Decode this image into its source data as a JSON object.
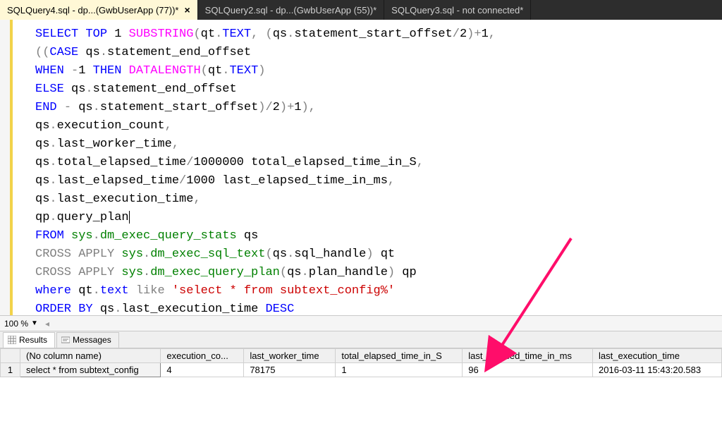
{
  "tabs": [
    {
      "label": "SQLQuery4.sql - dp...(GwbUserApp (77))*",
      "active": true
    },
    {
      "label": "SQLQuery2.sql - dp...(GwbUserApp (55))*",
      "active": false
    },
    {
      "label": "SQLQuery3.sql - not connected*",
      "active": false
    }
  ],
  "editor": {
    "lines": [
      [
        {
          "c": "kw",
          "t": "SELECT"
        },
        {
          "c": "id",
          "t": " "
        },
        {
          "c": "kw",
          "t": "TOP"
        },
        {
          "c": "id",
          "t": " "
        },
        {
          "c": "num",
          "t": "1"
        },
        {
          "c": "id",
          "t": " "
        },
        {
          "c": "fn",
          "t": "SUBSTRING"
        },
        {
          "c": "punc",
          "t": "("
        },
        {
          "c": "id",
          "t": "qt"
        },
        {
          "c": "punc",
          "t": "."
        },
        {
          "c": "kw",
          "t": "TEXT"
        },
        {
          "c": "punc",
          "t": ", ("
        },
        {
          "c": "id",
          "t": "qs"
        },
        {
          "c": "punc",
          "t": "."
        },
        {
          "c": "id",
          "t": "statement_start_offset"
        },
        {
          "c": "punc",
          "t": "/"
        },
        {
          "c": "num",
          "t": "2"
        },
        {
          "c": "punc",
          "t": ")+"
        },
        {
          "c": "num",
          "t": "1"
        },
        {
          "c": "punc",
          "t": ","
        }
      ],
      [
        {
          "c": "punc",
          "t": "(("
        },
        {
          "c": "kw",
          "t": "CASE"
        },
        {
          "c": "id",
          "t": " qs"
        },
        {
          "c": "punc",
          "t": "."
        },
        {
          "c": "id",
          "t": "statement_end_offset"
        }
      ],
      [
        {
          "c": "kw",
          "t": "WHEN"
        },
        {
          "c": "id",
          "t": " "
        },
        {
          "c": "punc",
          "t": "-"
        },
        {
          "c": "num",
          "t": "1"
        },
        {
          "c": "id",
          "t": " "
        },
        {
          "c": "kw",
          "t": "THEN"
        },
        {
          "c": "id",
          "t": " "
        },
        {
          "c": "fn",
          "t": "DATALENGTH"
        },
        {
          "c": "punc",
          "t": "("
        },
        {
          "c": "id",
          "t": "qt"
        },
        {
          "c": "punc",
          "t": "."
        },
        {
          "c": "kw",
          "t": "TEXT"
        },
        {
          "c": "punc",
          "t": ")"
        }
      ],
      [
        {
          "c": "kw",
          "t": "ELSE"
        },
        {
          "c": "id",
          "t": " qs"
        },
        {
          "c": "punc",
          "t": "."
        },
        {
          "c": "id",
          "t": "statement_end_offset"
        }
      ],
      [
        {
          "c": "kw",
          "t": "END"
        },
        {
          "c": "id",
          "t": " "
        },
        {
          "c": "punc",
          "t": "-"
        },
        {
          "c": "id",
          "t": " qs"
        },
        {
          "c": "punc",
          "t": "."
        },
        {
          "c": "id",
          "t": "statement_start_offset"
        },
        {
          "c": "punc",
          "t": ")/"
        },
        {
          "c": "num",
          "t": "2"
        },
        {
          "c": "punc",
          "t": ")+"
        },
        {
          "c": "num",
          "t": "1"
        },
        {
          "c": "punc",
          "t": "),"
        }
      ],
      [
        {
          "c": "id",
          "t": "qs"
        },
        {
          "c": "punc",
          "t": "."
        },
        {
          "c": "id",
          "t": "execution_count"
        },
        {
          "c": "punc",
          "t": ","
        }
      ],
      [
        {
          "c": "id",
          "t": "qs"
        },
        {
          "c": "punc",
          "t": "."
        },
        {
          "c": "id",
          "t": "last_worker_time"
        },
        {
          "c": "punc",
          "t": ","
        }
      ],
      [
        {
          "c": "id",
          "t": "qs"
        },
        {
          "c": "punc",
          "t": "."
        },
        {
          "c": "id",
          "t": "total_elapsed_time"
        },
        {
          "c": "punc",
          "t": "/"
        },
        {
          "c": "num",
          "t": "1000000"
        },
        {
          "c": "id",
          "t": " total_elapsed_time_in_S"
        },
        {
          "c": "punc",
          "t": ","
        }
      ],
      [
        {
          "c": "id",
          "t": "qs"
        },
        {
          "c": "punc",
          "t": "."
        },
        {
          "c": "id",
          "t": "last_elapsed_time"
        },
        {
          "c": "punc",
          "t": "/"
        },
        {
          "c": "num",
          "t": "1000"
        },
        {
          "c": "id",
          "t": " last_elapsed_time_in_ms"
        },
        {
          "c": "punc",
          "t": ","
        }
      ],
      [
        {
          "c": "id",
          "t": "qs"
        },
        {
          "c": "punc",
          "t": "."
        },
        {
          "c": "id",
          "t": "last_execution_time"
        },
        {
          "c": "punc",
          "t": ","
        }
      ],
      [
        {
          "c": "id",
          "t": "qp"
        },
        {
          "c": "punc",
          "t": "."
        },
        {
          "c": "id",
          "t": "query_plan"
        },
        {
          "c": "cursor",
          "t": ""
        }
      ],
      [
        {
          "c": "kw",
          "t": "FROM"
        },
        {
          "c": "id",
          "t": " "
        },
        {
          "c": "sys",
          "t": "sys"
        },
        {
          "c": "punc",
          "t": "."
        },
        {
          "c": "sys",
          "t": "dm_exec_query_stats"
        },
        {
          "c": "id",
          "t": " qs"
        }
      ],
      [
        {
          "c": "punc",
          "t": "CROSS APPLY "
        },
        {
          "c": "sys",
          "t": "sys"
        },
        {
          "c": "punc",
          "t": "."
        },
        {
          "c": "sys",
          "t": "dm_exec_sql_text"
        },
        {
          "c": "punc",
          "t": "("
        },
        {
          "c": "id",
          "t": "qs"
        },
        {
          "c": "punc",
          "t": "."
        },
        {
          "c": "id",
          "t": "sql_handle"
        },
        {
          "c": "punc",
          "t": ")"
        },
        {
          "c": "id",
          "t": " qt"
        }
      ],
      [
        {
          "c": "punc",
          "t": "CROSS APPLY "
        },
        {
          "c": "sys",
          "t": "sys"
        },
        {
          "c": "punc",
          "t": "."
        },
        {
          "c": "sys",
          "t": "dm_exec_query_plan"
        },
        {
          "c": "punc",
          "t": "("
        },
        {
          "c": "id",
          "t": "qs"
        },
        {
          "c": "punc",
          "t": "."
        },
        {
          "c": "id",
          "t": "plan_handle"
        },
        {
          "c": "punc",
          "t": ")"
        },
        {
          "c": "id",
          "t": " qp"
        }
      ],
      [
        {
          "c": "kw",
          "t": "where"
        },
        {
          "c": "id",
          "t": " qt"
        },
        {
          "c": "punc",
          "t": "."
        },
        {
          "c": "kw",
          "t": "text"
        },
        {
          "c": "id",
          "t": " "
        },
        {
          "c": "punc",
          "t": "like"
        },
        {
          "c": "id",
          "t": " "
        },
        {
          "c": "str",
          "t": "'select * from subtext_config%'"
        }
      ],
      [
        {
          "c": "kw",
          "t": "ORDER"
        },
        {
          "c": "id",
          "t": " "
        },
        {
          "c": "kw",
          "t": "BY"
        },
        {
          "c": "id",
          "t": " qs"
        },
        {
          "c": "punc",
          "t": "."
        },
        {
          "c": "id",
          "t": "last_execution_time"
        },
        {
          "c": "id",
          "t": " "
        },
        {
          "c": "kw",
          "t": "DESC"
        }
      ]
    ]
  },
  "zoom": {
    "value": "100 %"
  },
  "resultTabs": {
    "results": "Results",
    "messages": "Messages"
  },
  "grid": {
    "columns": [
      "",
      "(No column name)",
      "execution_co...",
      "last_worker_time",
      "total_elapsed_time_in_S",
      "last_elapsed_time_in_ms",
      "last_execution_time"
    ],
    "rows": [
      {
        "num": "1",
        "cells": [
          "select * from subtext_config",
          "4",
          "78175",
          "1",
          "96",
          "2016-03-11 15:43:20.583"
        ]
      }
    ]
  }
}
